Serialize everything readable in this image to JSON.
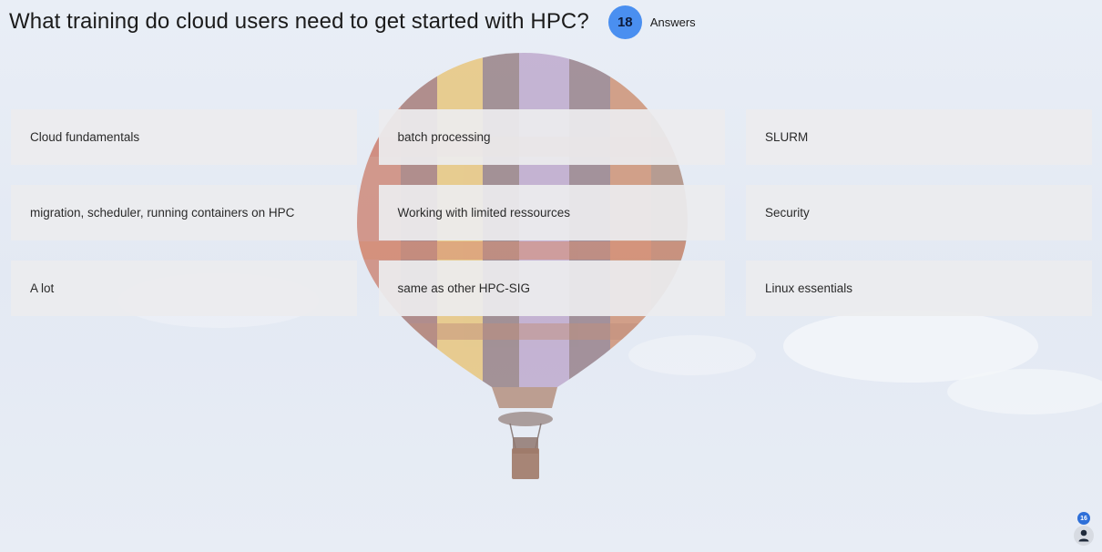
{
  "question": {
    "title": "What training do cloud users need to get started with HPC?",
    "answer_count": "18",
    "answer_count_label": "Answers"
  },
  "answers": [
    "Cloud fundamentals",
    "batch processing",
    "SLURM",
    "migration, scheduler, running containers on HPC",
    "Working with limited ressources",
    "Security",
    "A lot",
    "same as other HPC-SIG",
    "Linux essentials"
  ],
  "participants": {
    "count": "16",
    "icon": "person-icon"
  },
  "background": {
    "image": "hot-air-balloon-sky",
    "sky_color": "#e6ecf6"
  }
}
